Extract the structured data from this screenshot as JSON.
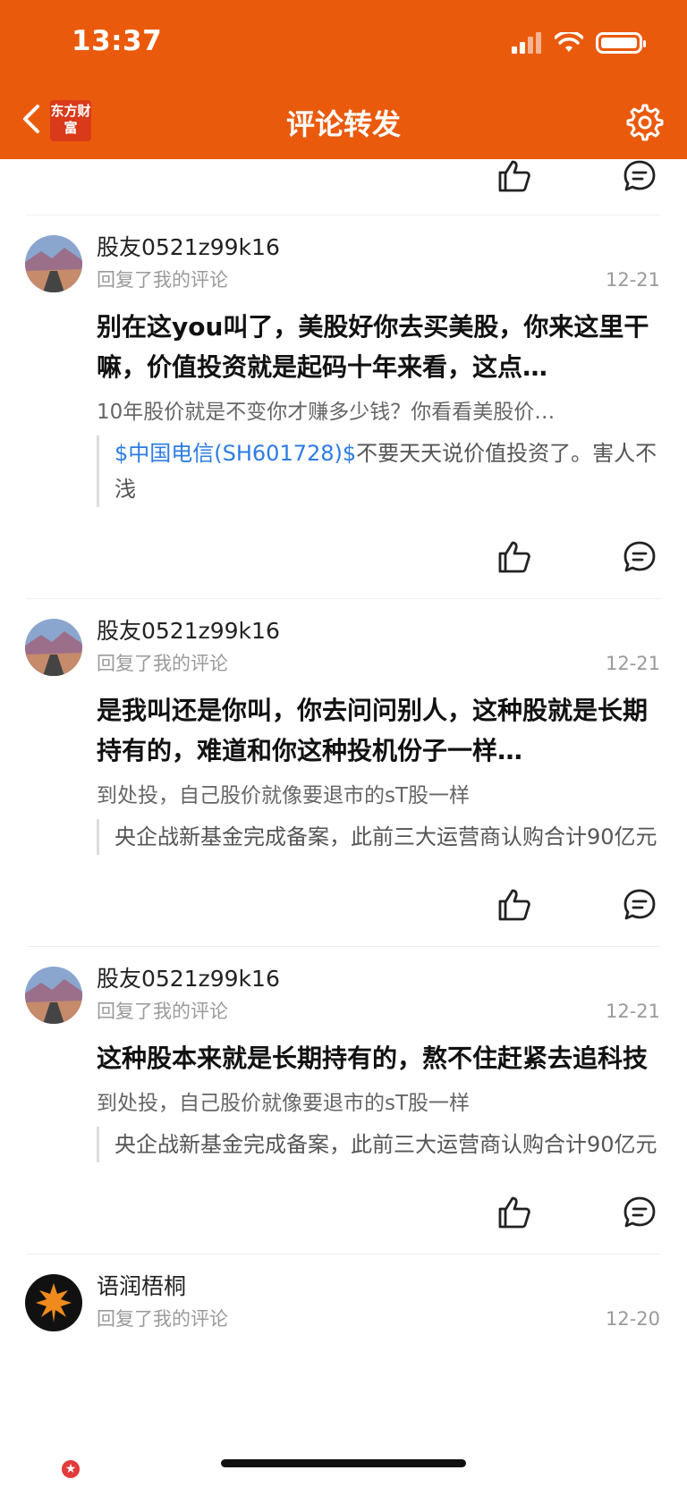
{
  "status_bar": {
    "time": "13:37"
  },
  "header": {
    "title": "评论转发",
    "logo_text": "东方财富"
  },
  "comments": [
    {
      "user": "股友0521z99k16",
      "action": "回复了我的评论",
      "date": "12-21",
      "main_text": "别在这you叫了，美股好你去买美股，你来这里干嘛，价值投资就是起码十年来看，这点…",
      "sub_text": "10年股价就是不变你才赚多少钱？你看看美股价…",
      "quote_link": "$中国电信(SH601728)$",
      "quote_text": "不要天天说价值投资了。害人不浅"
    },
    {
      "user": "股友0521z99k16",
      "action": "回复了我的评论",
      "date": "12-21",
      "main_text": "是我叫还是你叫，你去问问别人，这种股就是长期持有的，难道和你这种投机份子一样…",
      "sub_text": "到处投，自己股价就像要退市的sT股一样",
      "quote_link": "",
      "quote_text": "央企战新基金完成备案，此前三大运营商认购合计90亿元"
    },
    {
      "user": "股友0521z99k16",
      "action": "回复了我的评论",
      "date": "12-21",
      "main_text": "这种股本来就是长期持有的，熬不住赶紧去追科技",
      "sub_text": "到处投，自己股价就像要退市的sT股一样",
      "quote_link": "",
      "quote_text": "央企战新基金完成备案，此前三大运营商认购合计90亿元"
    },
    {
      "user": "语润梧桐",
      "action": "回复了我的评论",
      "date": "12-20"
    }
  ],
  "colors": {
    "brand": "#EA5A0C",
    "link": "#2c7be5"
  }
}
